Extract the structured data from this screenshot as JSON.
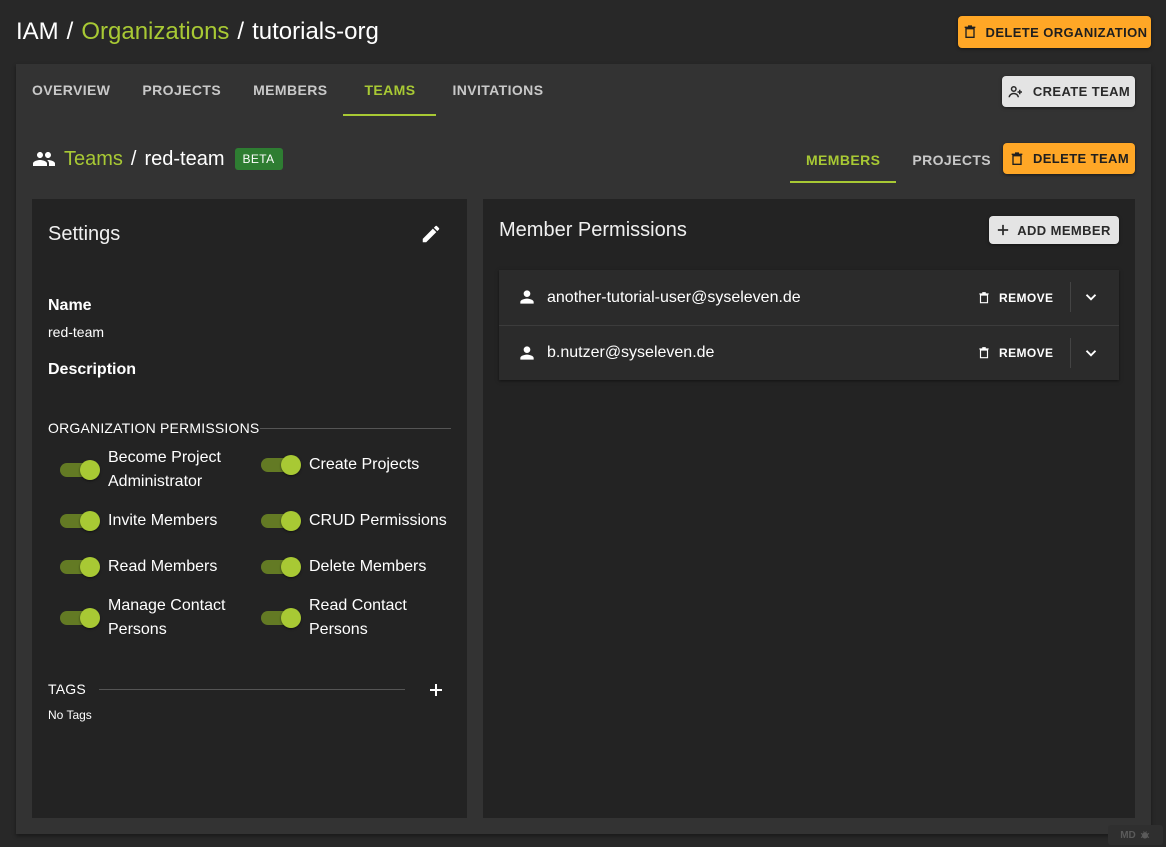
{
  "header": {
    "breadcrumb": {
      "root": "IAM",
      "sep1": "/",
      "organizations": "Organizations",
      "sep2": "/",
      "org": "tutorials-org"
    },
    "delete_org_label": "DELETE ORGANIZATION"
  },
  "tabs": {
    "items": [
      {
        "label": "OVERVIEW"
      },
      {
        "label": "PROJECTS"
      },
      {
        "label": "MEMBERS"
      },
      {
        "label": "TEAMS"
      },
      {
        "label": "INVITATIONS"
      }
    ],
    "active": "TEAMS"
  },
  "create_team_label": "CREATE TEAM",
  "team_header": {
    "teams_link": "Teams",
    "sep": "/",
    "team_name": "red-team",
    "badge": "BETA",
    "tabs": [
      {
        "label": "MEMBERS"
      },
      {
        "label": "PROJECTS"
      }
    ],
    "active_tab": "MEMBERS",
    "delete_team_label": "DELETE TEAM"
  },
  "settings": {
    "title": "Settings",
    "name_label": "Name",
    "name_value": "red-team",
    "description_label": "Description",
    "description_value": "",
    "org_permissions_title": "ORGANIZATION PERMISSIONS",
    "permissions": [
      {
        "label": "Become Project Administrator",
        "enabled": true
      },
      {
        "label": "Create Projects",
        "enabled": true
      },
      {
        "label": "Invite Members",
        "enabled": true
      },
      {
        "label": "CRUD Permissions",
        "enabled": true
      },
      {
        "label": "Read Members",
        "enabled": true
      },
      {
        "label": "Delete Members",
        "enabled": true
      },
      {
        "label": "Manage Contact Persons",
        "enabled": true
      },
      {
        "label": "Read Contact Persons",
        "enabled": true
      }
    ],
    "tags_title": "TAGS",
    "tags_empty": "No Tags"
  },
  "members": {
    "title": "Member Permissions",
    "add_member_label": "ADD MEMBER",
    "remove_label": "REMOVE",
    "list": [
      {
        "email": "another-tutorial-user@syseleven.de"
      },
      {
        "email": "b.nutzer@syseleven.de"
      }
    ]
  },
  "md_badge": "MD",
  "colors": {
    "accent": "#a8c934",
    "warning": "#ffa726",
    "beta": "#2e7d32",
    "background": "#282828",
    "panel": "#333333",
    "card": "#232323"
  },
  "icons": {
    "delete": "trash-icon",
    "create_team": "group-add-icon",
    "teams": "people-icon",
    "edit": "pencil-icon",
    "add": "plus-icon",
    "user": "person-icon",
    "expand": "chevron-down-icon",
    "debug": "bug-icon"
  }
}
